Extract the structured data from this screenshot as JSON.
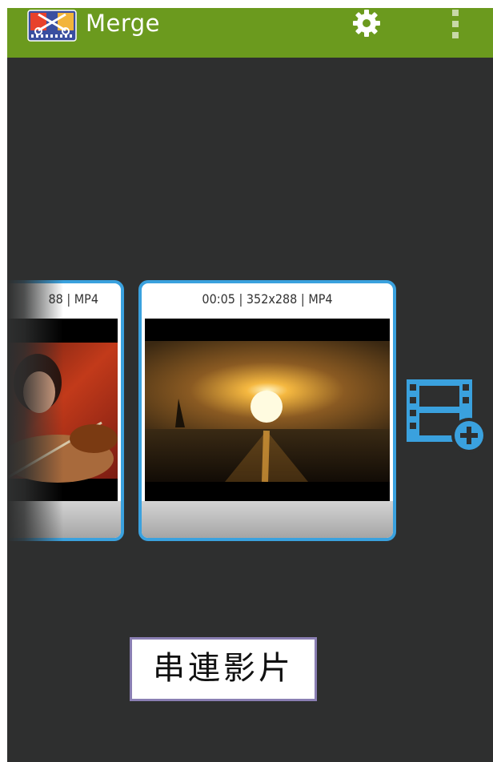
{
  "app": {
    "title": "Merge",
    "accent_color": "#6b9a1e",
    "card_border_color": "#3aa1de",
    "app_icon": "film-scissors-icon",
    "settings_icon": "gear-icon",
    "overflow_icon": "overflow-menu-icon"
  },
  "clips": [
    {
      "meta": "88 | MP4",
      "thumbnail": "violinist-thumbnail"
    },
    {
      "meta": "00:05 | 352x288 | MP4",
      "thumbnail": "sunset-sailboat-thumbnail"
    }
  ],
  "add_button": {
    "icon": "add-video-icon"
  },
  "caption": {
    "text": "串連影片"
  }
}
